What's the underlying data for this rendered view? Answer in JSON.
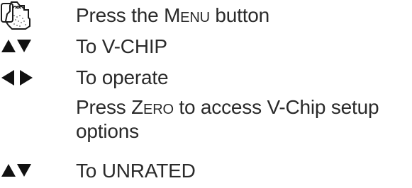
{
  "steps": [
    {
      "icon": "hand-pressing-remote-icon",
      "text_before": "Press the ",
      "keyword": "Menu",
      "text_after": " button"
    },
    {
      "icon": "up-down-arrows-icon",
      "text": "To V-CHIP"
    },
    {
      "icon": "left-right-arrows-icon",
      "text": "To operate"
    },
    {
      "icon": "",
      "text_before": "Press ",
      "keyword": "Zero",
      "text_after": " to access V-Chip setup options"
    },
    {
      "icon": "up-down-arrows-icon",
      "text": "To UNRATED"
    }
  ]
}
